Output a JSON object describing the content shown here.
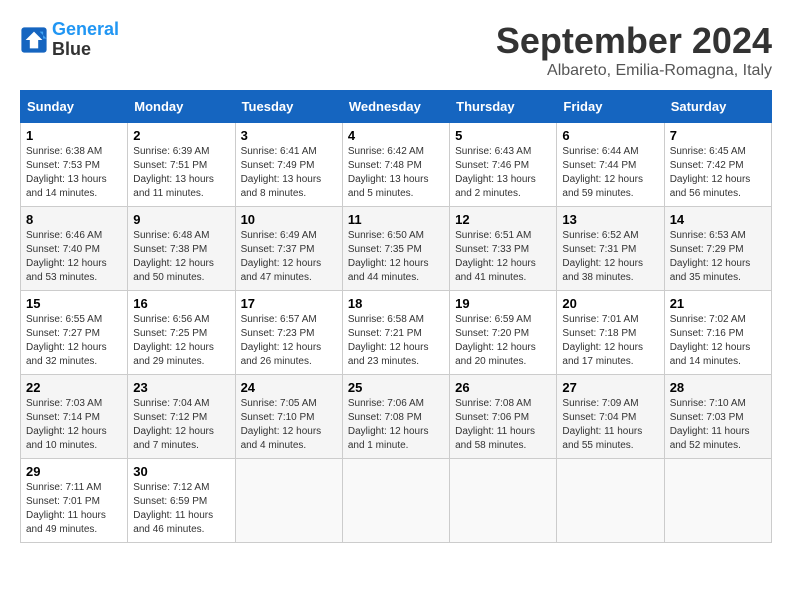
{
  "logo": {
    "line1": "General",
    "line2": "Blue"
  },
  "title": "September 2024",
  "location": "Albareto, Emilia-Romagna, Italy",
  "weekdays": [
    "Sunday",
    "Monday",
    "Tuesday",
    "Wednesday",
    "Thursday",
    "Friday",
    "Saturday"
  ],
  "weeks": [
    [
      {
        "day": "1",
        "sunrise": "6:38 AM",
        "sunset": "7:53 PM",
        "daylight": "13 hours and 14 minutes."
      },
      {
        "day": "2",
        "sunrise": "6:39 AM",
        "sunset": "7:51 PM",
        "daylight": "13 hours and 11 minutes."
      },
      {
        "day": "3",
        "sunrise": "6:41 AM",
        "sunset": "7:49 PM",
        "daylight": "13 hours and 8 minutes."
      },
      {
        "day": "4",
        "sunrise": "6:42 AM",
        "sunset": "7:48 PM",
        "daylight": "13 hours and 5 minutes."
      },
      {
        "day": "5",
        "sunrise": "6:43 AM",
        "sunset": "7:46 PM",
        "daylight": "13 hours and 2 minutes."
      },
      {
        "day": "6",
        "sunrise": "6:44 AM",
        "sunset": "7:44 PM",
        "daylight": "12 hours and 59 minutes."
      },
      {
        "day": "7",
        "sunrise": "6:45 AM",
        "sunset": "7:42 PM",
        "daylight": "12 hours and 56 minutes."
      }
    ],
    [
      {
        "day": "8",
        "sunrise": "6:46 AM",
        "sunset": "7:40 PM",
        "daylight": "12 hours and 53 minutes."
      },
      {
        "day": "9",
        "sunrise": "6:48 AM",
        "sunset": "7:38 PM",
        "daylight": "12 hours and 50 minutes."
      },
      {
        "day": "10",
        "sunrise": "6:49 AM",
        "sunset": "7:37 PM",
        "daylight": "12 hours and 47 minutes."
      },
      {
        "day": "11",
        "sunrise": "6:50 AM",
        "sunset": "7:35 PM",
        "daylight": "12 hours and 44 minutes."
      },
      {
        "day": "12",
        "sunrise": "6:51 AM",
        "sunset": "7:33 PM",
        "daylight": "12 hours and 41 minutes."
      },
      {
        "day": "13",
        "sunrise": "6:52 AM",
        "sunset": "7:31 PM",
        "daylight": "12 hours and 38 minutes."
      },
      {
        "day": "14",
        "sunrise": "6:53 AM",
        "sunset": "7:29 PM",
        "daylight": "12 hours and 35 minutes."
      }
    ],
    [
      {
        "day": "15",
        "sunrise": "6:55 AM",
        "sunset": "7:27 PM",
        "daylight": "12 hours and 32 minutes."
      },
      {
        "day": "16",
        "sunrise": "6:56 AM",
        "sunset": "7:25 PM",
        "daylight": "12 hours and 29 minutes."
      },
      {
        "day": "17",
        "sunrise": "6:57 AM",
        "sunset": "7:23 PM",
        "daylight": "12 hours and 26 minutes."
      },
      {
        "day": "18",
        "sunrise": "6:58 AM",
        "sunset": "7:21 PM",
        "daylight": "12 hours and 23 minutes."
      },
      {
        "day": "19",
        "sunrise": "6:59 AM",
        "sunset": "7:20 PM",
        "daylight": "12 hours and 20 minutes."
      },
      {
        "day": "20",
        "sunrise": "7:01 AM",
        "sunset": "7:18 PM",
        "daylight": "12 hours and 17 minutes."
      },
      {
        "day": "21",
        "sunrise": "7:02 AM",
        "sunset": "7:16 PM",
        "daylight": "12 hours and 14 minutes."
      }
    ],
    [
      {
        "day": "22",
        "sunrise": "7:03 AM",
        "sunset": "7:14 PM",
        "daylight": "12 hours and 10 minutes."
      },
      {
        "day": "23",
        "sunrise": "7:04 AM",
        "sunset": "7:12 PM",
        "daylight": "12 hours and 7 minutes."
      },
      {
        "day": "24",
        "sunrise": "7:05 AM",
        "sunset": "7:10 PM",
        "daylight": "12 hours and 4 minutes."
      },
      {
        "day": "25",
        "sunrise": "7:06 AM",
        "sunset": "7:08 PM",
        "daylight": "12 hours and 1 minute."
      },
      {
        "day": "26",
        "sunrise": "7:08 AM",
        "sunset": "7:06 PM",
        "daylight": "11 hours and 58 minutes."
      },
      {
        "day": "27",
        "sunrise": "7:09 AM",
        "sunset": "7:04 PM",
        "daylight": "11 hours and 55 minutes."
      },
      {
        "day": "28",
        "sunrise": "7:10 AM",
        "sunset": "7:03 PM",
        "daylight": "11 hours and 52 minutes."
      }
    ],
    [
      {
        "day": "29",
        "sunrise": "7:11 AM",
        "sunset": "7:01 PM",
        "daylight": "11 hours and 49 minutes."
      },
      {
        "day": "30",
        "sunrise": "7:12 AM",
        "sunset": "6:59 PM",
        "daylight": "11 hours and 46 minutes."
      },
      null,
      null,
      null,
      null,
      null
    ]
  ]
}
